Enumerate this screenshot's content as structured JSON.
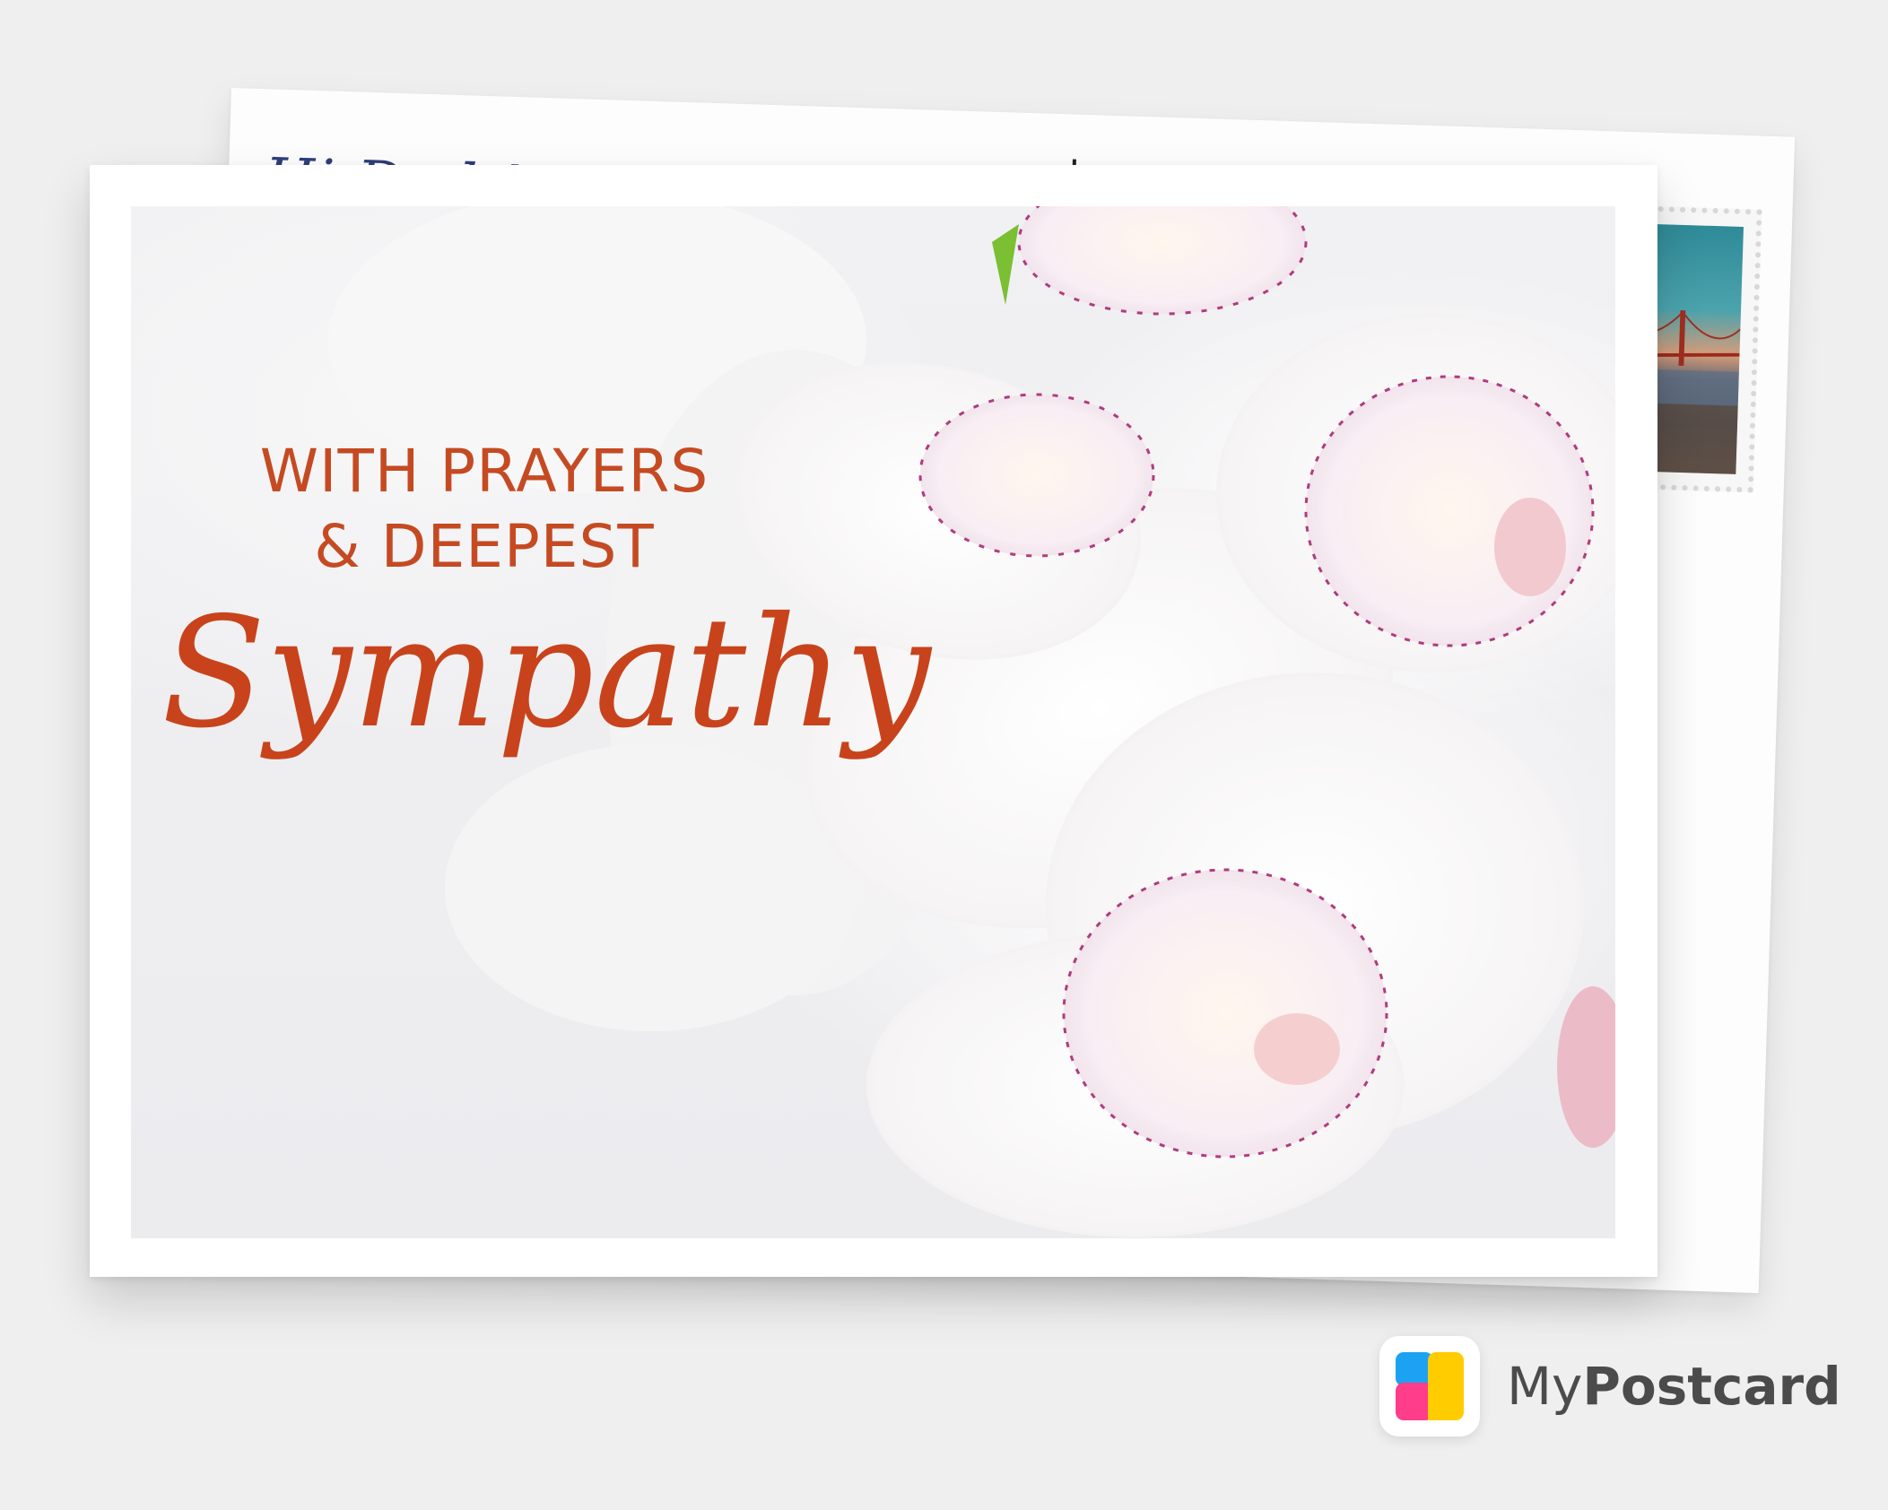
{
  "back_card": {
    "greeting_partial": "Hi Dad !",
    "stamp": {
      "image": "golden-gate-bridge-stamp"
    }
  },
  "front_card": {
    "line1": "WITH PRAYERS",
    "line2": "& DEEPEST",
    "script": "Sympathy",
    "image": "white-orchids-photo"
  },
  "brand": {
    "name_part1": "My",
    "name_part2": "Postcard",
    "logo_colors": [
      "#1da1f2",
      "#ff3d8b",
      "#ffcc00"
    ]
  },
  "colors": {
    "greeting_text": "#c8431b",
    "background": "#efefef"
  }
}
